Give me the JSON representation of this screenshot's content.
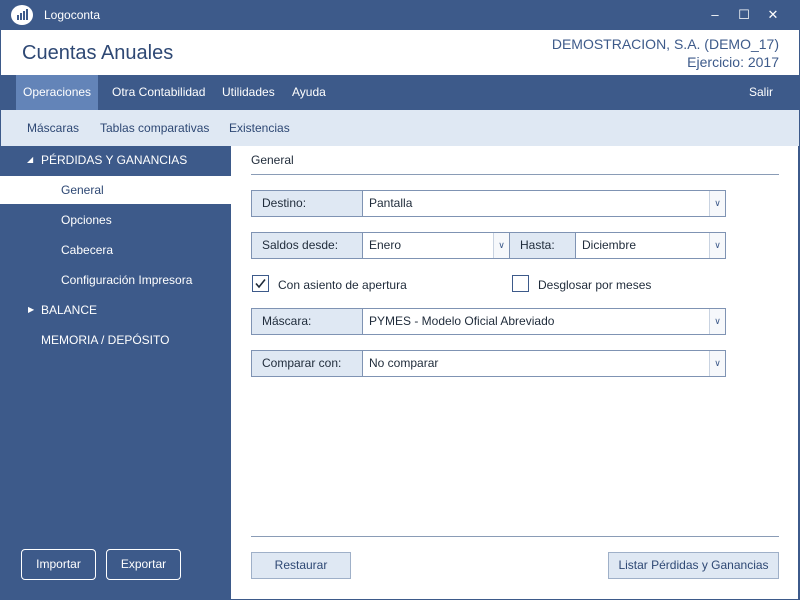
{
  "app": {
    "title": "Logoconta"
  },
  "window": {
    "minimize": "–",
    "maximize": "☐",
    "close": "✕"
  },
  "header": {
    "title": "Cuentas Anuales",
    "company": "DEMOSTRACION, S.A. (DEMO_17)",
    "year": "Ejercicio: 2017"
  },
  "menu": {
    "items": [
      {
        "label": "Operaciones"
      },
      {
        "label": "Otra Contabilidad"
      },
      {
        "label": "Utilidades"
      },
      {
        "label": "Ayuda"
      }
    ],
    "exit": "Salir"
  },
  "submenu": {
    "items": [
      {
        "label": "Máscaras"
      },
      {
        "label": "Tablas comparativas"
      },
      {
        "label": "Existencias"
      }
    ]
  },
  "sidebar": {
    "items": [
      {
        "label": "PÉRDIDAS Y GANANCIAS"
      },
      {
        "label": "General"
      },
      {
        "label": "Opciones"
      },
      {
        "label": "Cabecera"
      },
      {
        "label": "Configuración Impresora"
      },
      {
        "label": "BALANCE"
      },
      {
        "label": "MEMORIA / DEPÓSITO"
      }
    ],
    "import_label": "Importar",
    "export_label": "Exportar"
  },
  "content": {
    "section_title": "General",
    "destino_label": "Destino:",
    "destino_value": "Pantalla",
    "saldos_label": "Saldos desde:",
    "saldos_value": "Enero",
    "hasta_label": "Hasta:",
    "hasta_value": "Diciembre",
    "asiento_label": "Con asiento de apertura",
    "asiento_checked": true,
    "desglosar_label": "Desglosar por meses",
    "desglosar_checked": false,
    "mascara_label": "Máscara:",
    "mascara_value": "PYMES - Modelo Oficial Abreviado",
    "comparar_label": "Comparar con:",
    "comparar_value": "No comparar",
    "restore_label": "Restaurar",
    "list_label": "Listar Pérdidas y Ganancias"
  }
}
